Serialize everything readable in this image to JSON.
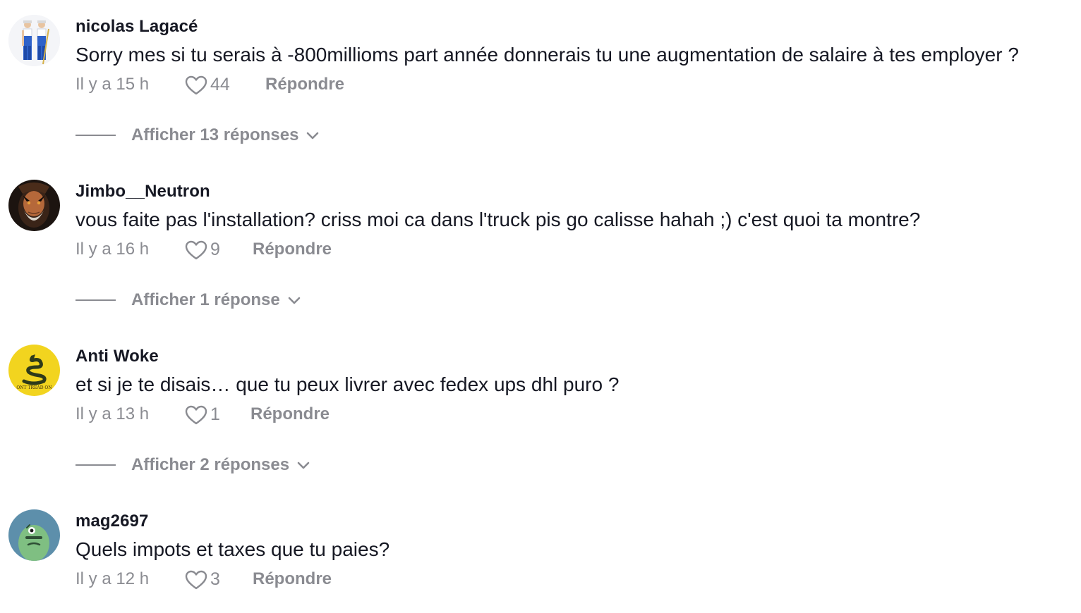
{
  "comments": [
    {
      "username": "nicolas Lagacé",
      "avatar_icon": "two-workers-avatar",
      "text": "Sorry mes si tu serais à -800millioms part année donnerais tu une augmentation de salaire à tes employer ?",
      "time": "Il y a 15 h",
      "likes": "44",
      "reply_label": "Répondre",
      "replies_label": "Afficher 13 réponses"
    },
    {
      "username": "Jimbo__Neutron",
      "avatar_icon": "bearded-man-avatar",
      "text": "vous faite pas l'installation? criss moi ca dans l'truck pis go calisse hahah ;) c'est quoi ta montre?",
      "time": "Il y a 16 h",
      "likes": "9",
      "reply_label": "Répondre",
      "replies_label": "Afficher 1 réponse"
    },
    {
      "username": "Anti Woke",
      "avatar_icon": "gadsden-snake-flag-avatar",
      "avatar_text": "ONT TREAD ON",
      "text": "et si je te disais… que tu peux livrer avec fedex ups dhl puro ?",
      "time": "Il y a 13 h",
      "likes": "1",
      "reply_label": "Répondre",
      "replies_label": "Afficher 2 réponses"
    },
    {
      "username": "mag2697",
      "avatar_icon": "green-character-avatar",
      "text": "Quels impots et taxes que tu paies?",
      "time": "Il y a 12 h",
      "likes": "3",
      "reply_label": "Répondre"
    }
  ],
  "colors": {
    "primary_text": "#161823",
    "secondary_text": "#8a8b91",
    "background": "#ffffff"
  }
}
